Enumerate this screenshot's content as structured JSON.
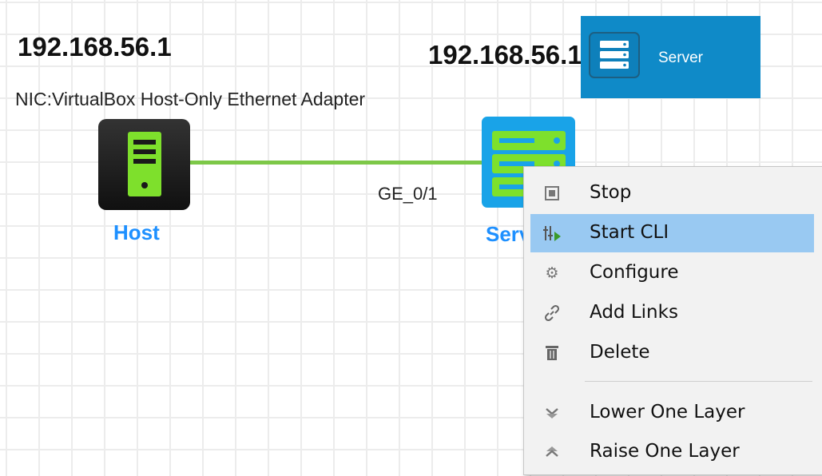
{
  "topology": {
    "host": {
      "ip": "192.168.56.1",
      "nic": "NIC:VirtualBox Host-Only Ethernet Adapter",
      "label": "Host",
      "icon": "host-icon"
    },
    "server": {
      "ip": "192.168.56.1",
      "label": "Server",
      "icon": "server-icon"
    },
    "link": {
      "port": "GE_0/1",
      "color": "#7dc848"
    }
  },
  "tooltip": {
    "text": "Server",
    "icon": "server-icon",
    "background": "#0f8ac8"
  },
  "context_menu": {
    "items": [
      {
        "label": "Stop",
        "icon": "stop-icon"
      },
      {
        "label": "Start CLI",
        "icon": "cli-icon",
        "highlighted": true
      },
      {
        "label": "Configure",
        "icon": "gear-icon"
      },
      {
        "label": "Add Links",
        "icon": "link-icon"
      },
      {
        "label": "Delete",
        "icon": "trash-icon"
      },
      {
        "label": "Lower One Layer",
        "icon": "lower-layer-icon"
      },
      {
        "label": "Raise One Layer",
        "icon": "raise-layer-icon"
      }
    ],
    "highlight_color": "#99c9f2"
  }
}
